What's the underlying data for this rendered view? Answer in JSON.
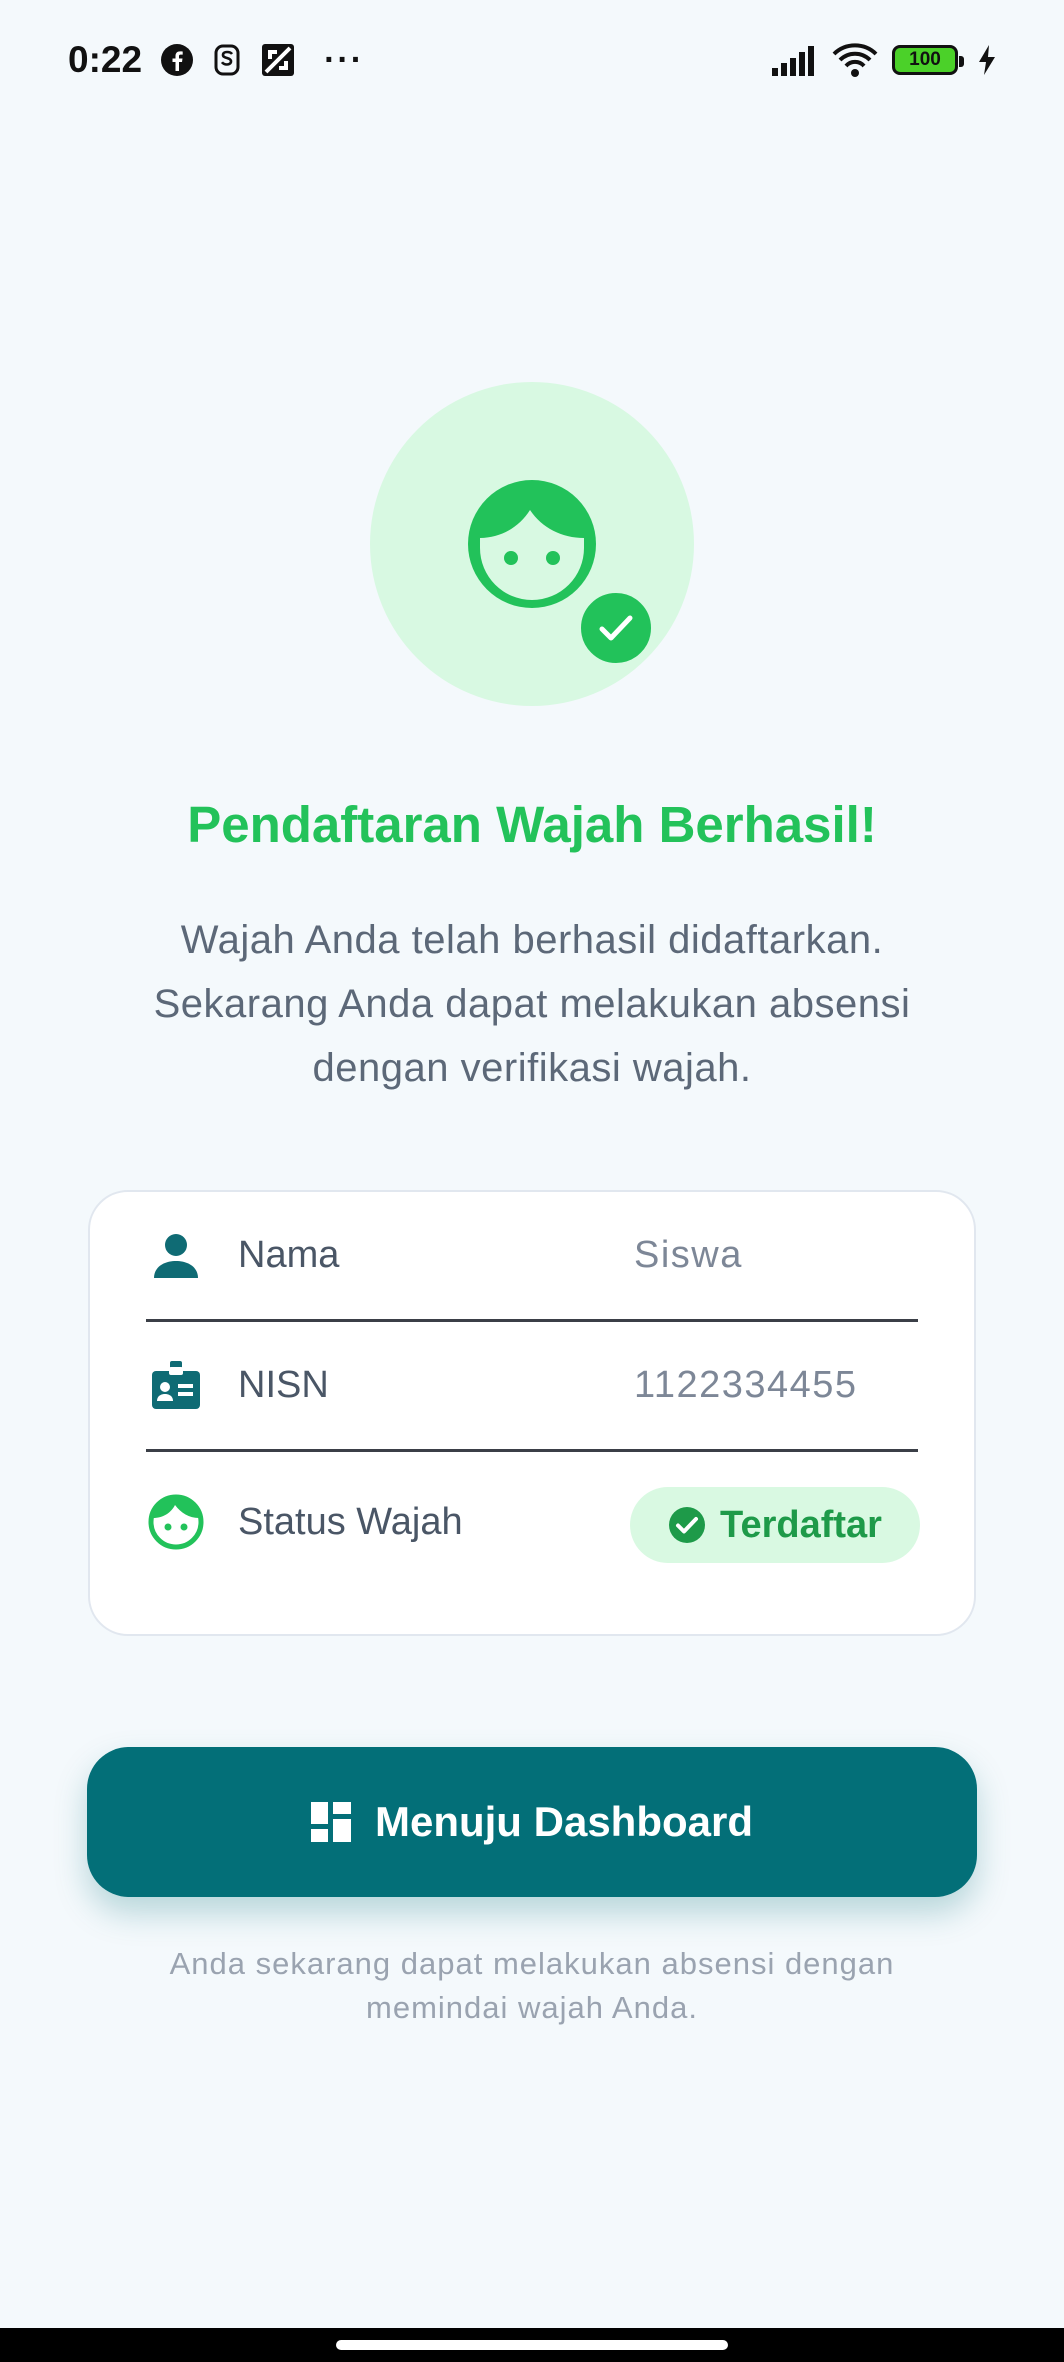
{
  "status_bar": {
    "time": "0:22",
    "battery": "100",
    "more": "···",
    "icons": [
      "facebook-icon",
      "notification-s-icon",
      "screenshot-icon",
      "signal-icon",
      "wifi-icon",
      "battery-icon",
      "charging-icon"
    ]
  },
  "hero": {
    "icon": "face-icon",
    "badge_icon": "check-icon",
    "title": "Pendaftaran Wajah Berhasil!",
    "description": "Wajah Anda telah berhasil didaftarkan. Sekarang Anda dapat melakukan absensi dengan verifikasi wajah."
  },
  "info": {
    "rows": [
      {
        "label": "Nama",
        "value": "Siswa",
        "icon": "person-icon"
      },
      {
        "label": "NISN",
        "value": "1122334455",
        "icon": "id-badge-icon"
      },
      {
        "label": "Status Wajah",
        "icon": "face-icon"
      }
    ],
    "status_badge": "Terdaftar"
  },
  "action": {
    "button_label": "Menuju Dashboard",
    "button_icon": "dashboard-icon",
    "footer_note": "Anda sekarang dapat melakukan absensi dengan memindai wajah Anda."
  },
  "colors": {
    "primary": "#036f78",
    "success": "#23c25a",
    "background": "#f4f9fc"
  }
}
